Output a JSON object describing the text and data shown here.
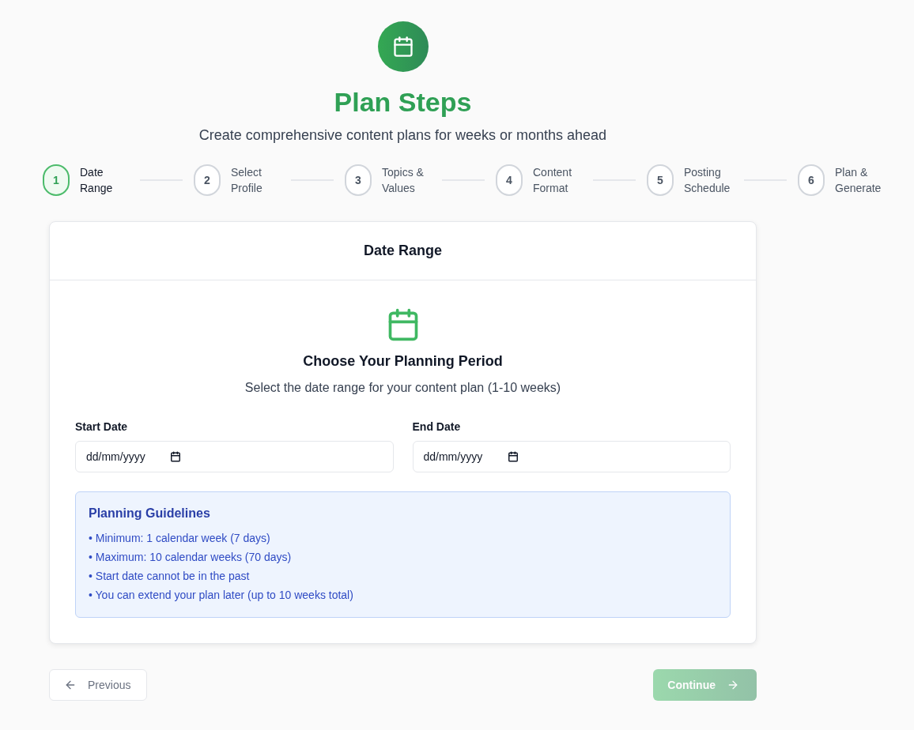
{
  "header": {
    "title": "Plan Steps",
    "subtitle": "Create comprehensive content plans for weeks or months ahead"
  },
  "steps": [
    {
      "number": "1",
      "label": "Date Range",
      "selected": true
    },
    {
      "number": "2",
      "label": "Select Profile",
      "selected": false
    },
    {
      "number": "3",
      "label": "Topics & Values",
      "selected": false
    },
    {
      "number": "4",
      "label": "Content Format",
      "selected": false
    },
    {
      "number": "5",
      "label": "Posting Schedule",
      "selected": false
    },
    {
      "number": "6",
      "label": "Plan & Generate",
      "selected": false
    }
  ],
  "card": {
    "title": "Date Range",
    "heading": "Choose Your Planning Period",
    "description": "Select the date range for your content plan (1-10 weeks)",
    "fields": [
      {
        "label": "Start Date",
        "placeholder": "dd/mm/yyyy"
      },
      {
        "label": "End Date",
        "placeholder": "dd/mm/yyyy"
      }
    ],
    "guidelines": {
      "title": "Planning Guidelines",
      "items": [
        "• Minimum: 1 calendar week (7 days)",
        "• Maximum: 10 calendar weeks (70 days)",
        "• Start date cannot be in the past",
        "• You can extend your plan later (up to 10 weeks total)"
      ]
    }
  },
  "buttons": [
    {
      "kind": "previous",
      "label": "Previous",
      "disabled": true
    },
    {
      "kind": "continue",
      "label": "Continue",
      "disabled": true
    }
  ]
}
